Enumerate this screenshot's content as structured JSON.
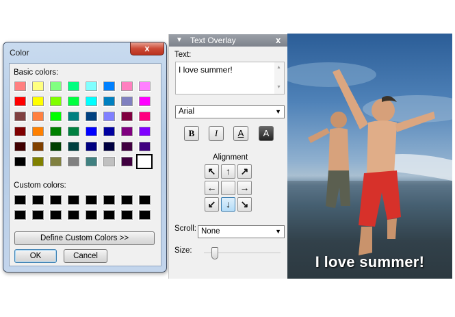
{
  "color_dialog": {
    "title": "Color",
    "close_label": "x",
    "basic_colors_label": "Basic colors:",
    "basic_colors": [
      [
        "#ff8080",
        "#ffff80",
        "#80ff80",
        "#00ff80",
        "#80ffff",
        "#0080ff",
        "#ff80c0",
        "#ff80ff"
      ],
      [
        "#ff0000",
        "#ffff00",
        "#80ff00",
        "#00ff40",
        "#00ffff",
        "#0080c0",
        "#8080c0",
        "#ff00ff"
      ],
      [
        "#804040",
        "#ff8040",
        "#00ff00",
        "#008080",
        "#004080",
        "#8080ff",
        "#800040",
        "#ff0080"
      ],
      [
        "#800000",
        "#ff8000",
        "#008000",
        "#008040",
        "#0000ff",
        "#0000a0",
        "#800080",
        "#8000ff"
      ],
      [
        "#400000",
        "#804000",
        "#004000",
        "#004040",
        "#000080",
        "#000040",
        "#400040",
        "#400080"
      ],
      [
        "#000000",
        "#808000",
        "#808040",
        "#808080",
        "#408080",
        "#c0c0c0",
        "#400040",
        "#ffffff"
      ]
    ],
    "selected_color": "#ffffff",
    "custom_colors_label": "Custom colors:",
    "custom_colors": [
      [
        "#000000",
        "#000000",
        "#000000",
        "#000000",
        "#000000",
        "#000000",
        "#000000",
        "#000000"
      ],
      [
        "#000000",
        "#000000",
        "#000000",
        "#000000",
        "#000000",
        "#000000",
        "#000000",
        "#000000"
      ]
    ],
    "define_custom_label": "Define Custom Colors >>",
    "ok_label": "OK",
    "cancel_label": "Cancel"
  },
  "text_overlay": {
    "title": "Text Overlay",
    "close_label": "x",
    "text_label": "Text:",
    "text_value": "I love summer!",
    "font_value": "Arial",
    "style_buttons": [
      "B",
      "I",
      "A",
      "A"
    ],
    "alignment_label": "Alignment",
    "alignment_arrows": [
      "↖",
      "↑",
      "↗",
      "←",
      "",
      "→",
      "↙",
      "↓",
      "↘"
    ],
    "alignment_selected": "bottom-center",
    "scroll_label": "Scroll:",
    "scroll_value": "None",
    "size_label": "Size:",
    "size_level": 0.1
  },
  "photo": {
    "overlay_text": "I love summer!"
  }
}
